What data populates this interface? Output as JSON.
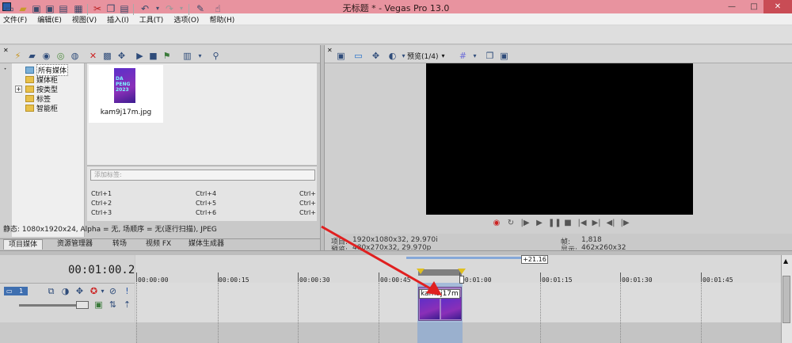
{
  "window": {
    "title": "无标题 * - Vegas Pro 13.0",
    "minimize": "—",
    "maximize": "□",
    "close": "✕"
  },
  "menu": [
    "文件(F)",
    "编辑(E)",
    "视图(V)",
    "插入(I)",
    "工具(T)",
    "选项(O)",
    "帮助(H)"
  ],
  "explorer": {
    "tree": [
      "所有媒体",
      "媒体柜",
      "按类型",
      "标签",
      "智能柜"
    ],
    "expand_glyph": "+"
  },
  "media": {
    "file_name": "kam9j17m.jpg",
    "thumb_lines": [
      "DA",
      "PENG",
      "2023"
    ],
    "tag_placeholder": "添加标签:",
    "shortcuts": [
      [
        "Ctrl+1",
        "Ctrl+4",
        "Ctrl+"
      ],
      [
        "Ctrl+2",
        "Ctrl+5",
        "Ctrl+"
      ],
      [
        "Ctrl+3",
        "Ctrl+6",
        "Ctrl+"
      ]
    ],
    "status": "静态: 1080x1920x24, Alpha = 无, 场顺序 = 无(逐行扫描), JPEG"
  },
  "tabs": [
    "项目媒体",
    "资源管理器",
    "转场",
    "视频 FX",
    "媒体生成器"
  ],
  "preview": {
    "mode_label": "预览(1/4)",
    "project_label": "项目:",
    "project_value": "1920x1080x32, 29.970i",
    "preview_label": "预览:",
    "preview_value": "480x270x32, 29.970p",
    "frame_label": "帧:",
    "frame_value": "1,818",
    "display_label": "显示:",
    "display_value": "462x260x32"
  },
  "timeline": {
    "timecode": "00:01:00.20",
    "offset": "+21.16",
    "ticks": [
      "00:00:00",
      "00:00:15",
      "00:00:30",
      "00:00:45",
      "00:01:00",
      "00:01:15",
      "00:01:30",
      "00:01:45"
    ],
    "clip_label": "kam9j17m",
    "track_number": "1"
  }
}
